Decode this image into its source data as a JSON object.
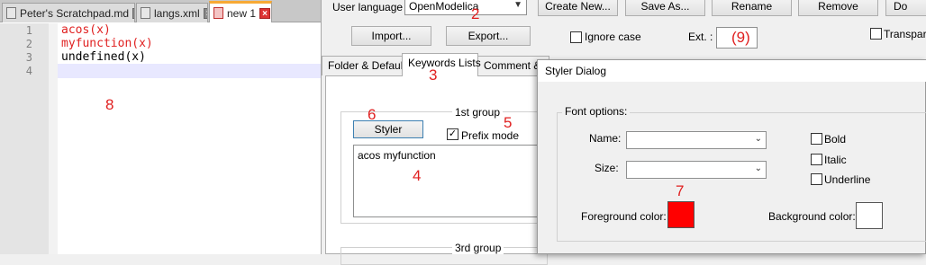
{
  "editor": {
    "tabs": [
      {
        "label": "Peter's Scratchpad.md"
      },
      {
        "label": "langs.xml"
      },
      {
        "label": "new 1"
      }
    ],
    "line_numbers": [
      "1",
      "2",
      "3",
      "4"
    ],
    "lines": [
      "acos(x)",
      "myfunction(x)",
      "undefined(x)",
      ""
    ],
    "annotation": "8"
  },
  "config": {
    "user_language_label": "User language :",
    "user_language_value": "OpenModelica",
    "create_new_label": "Create New...",
    "save_as_label": "Save As...",
    "rename_label": "Rename",
    "remove_label": "Remove",
    "do_label": "Do",
    "import_label": "Import...",
    "export_label": "Export...",
    "ignore_case_label": "Ignore case",
    "ext_label": "Ext. :",
    "transparent_label": "Transpare",
    "tabs": [
      {
        "label": "Folder & Default"
      },
      {
        "label": "Keywords Lists"
      },
      {
        "label": "Comment & N"
      }
    ],
    "group1_title": "1st group",
    "styler_label": "Styler",
    "prefix_mode_label": "Prefix mode",
    "prefix_mode_checked": "✓",
    "keywords_text": "acos myfunction",
    "group3_title": "3rd group",
    "annotations": {
      "a2": "2",
      "a3": "3",
      "a4": "4",
      "a5": "5",
      "a6": "6",
      "a9": "(9)"
    }
  },
  "dialog": {
    "title": "Styler Dialog",
    "font_options_label": "Font options:",
    "name_label": "Name:",
    "size_label": "Size:",
    "bold_label": "Bold",
    "italic_label": "Italic",
    "underline_label": "Underline",
    "fg_label": "Foreground color:",
    "bg_label": "Background color:",
    "fg_color": "#ff0000",
    "bg_color": "#ffffff",
    "annotation": "7"
  }
}
